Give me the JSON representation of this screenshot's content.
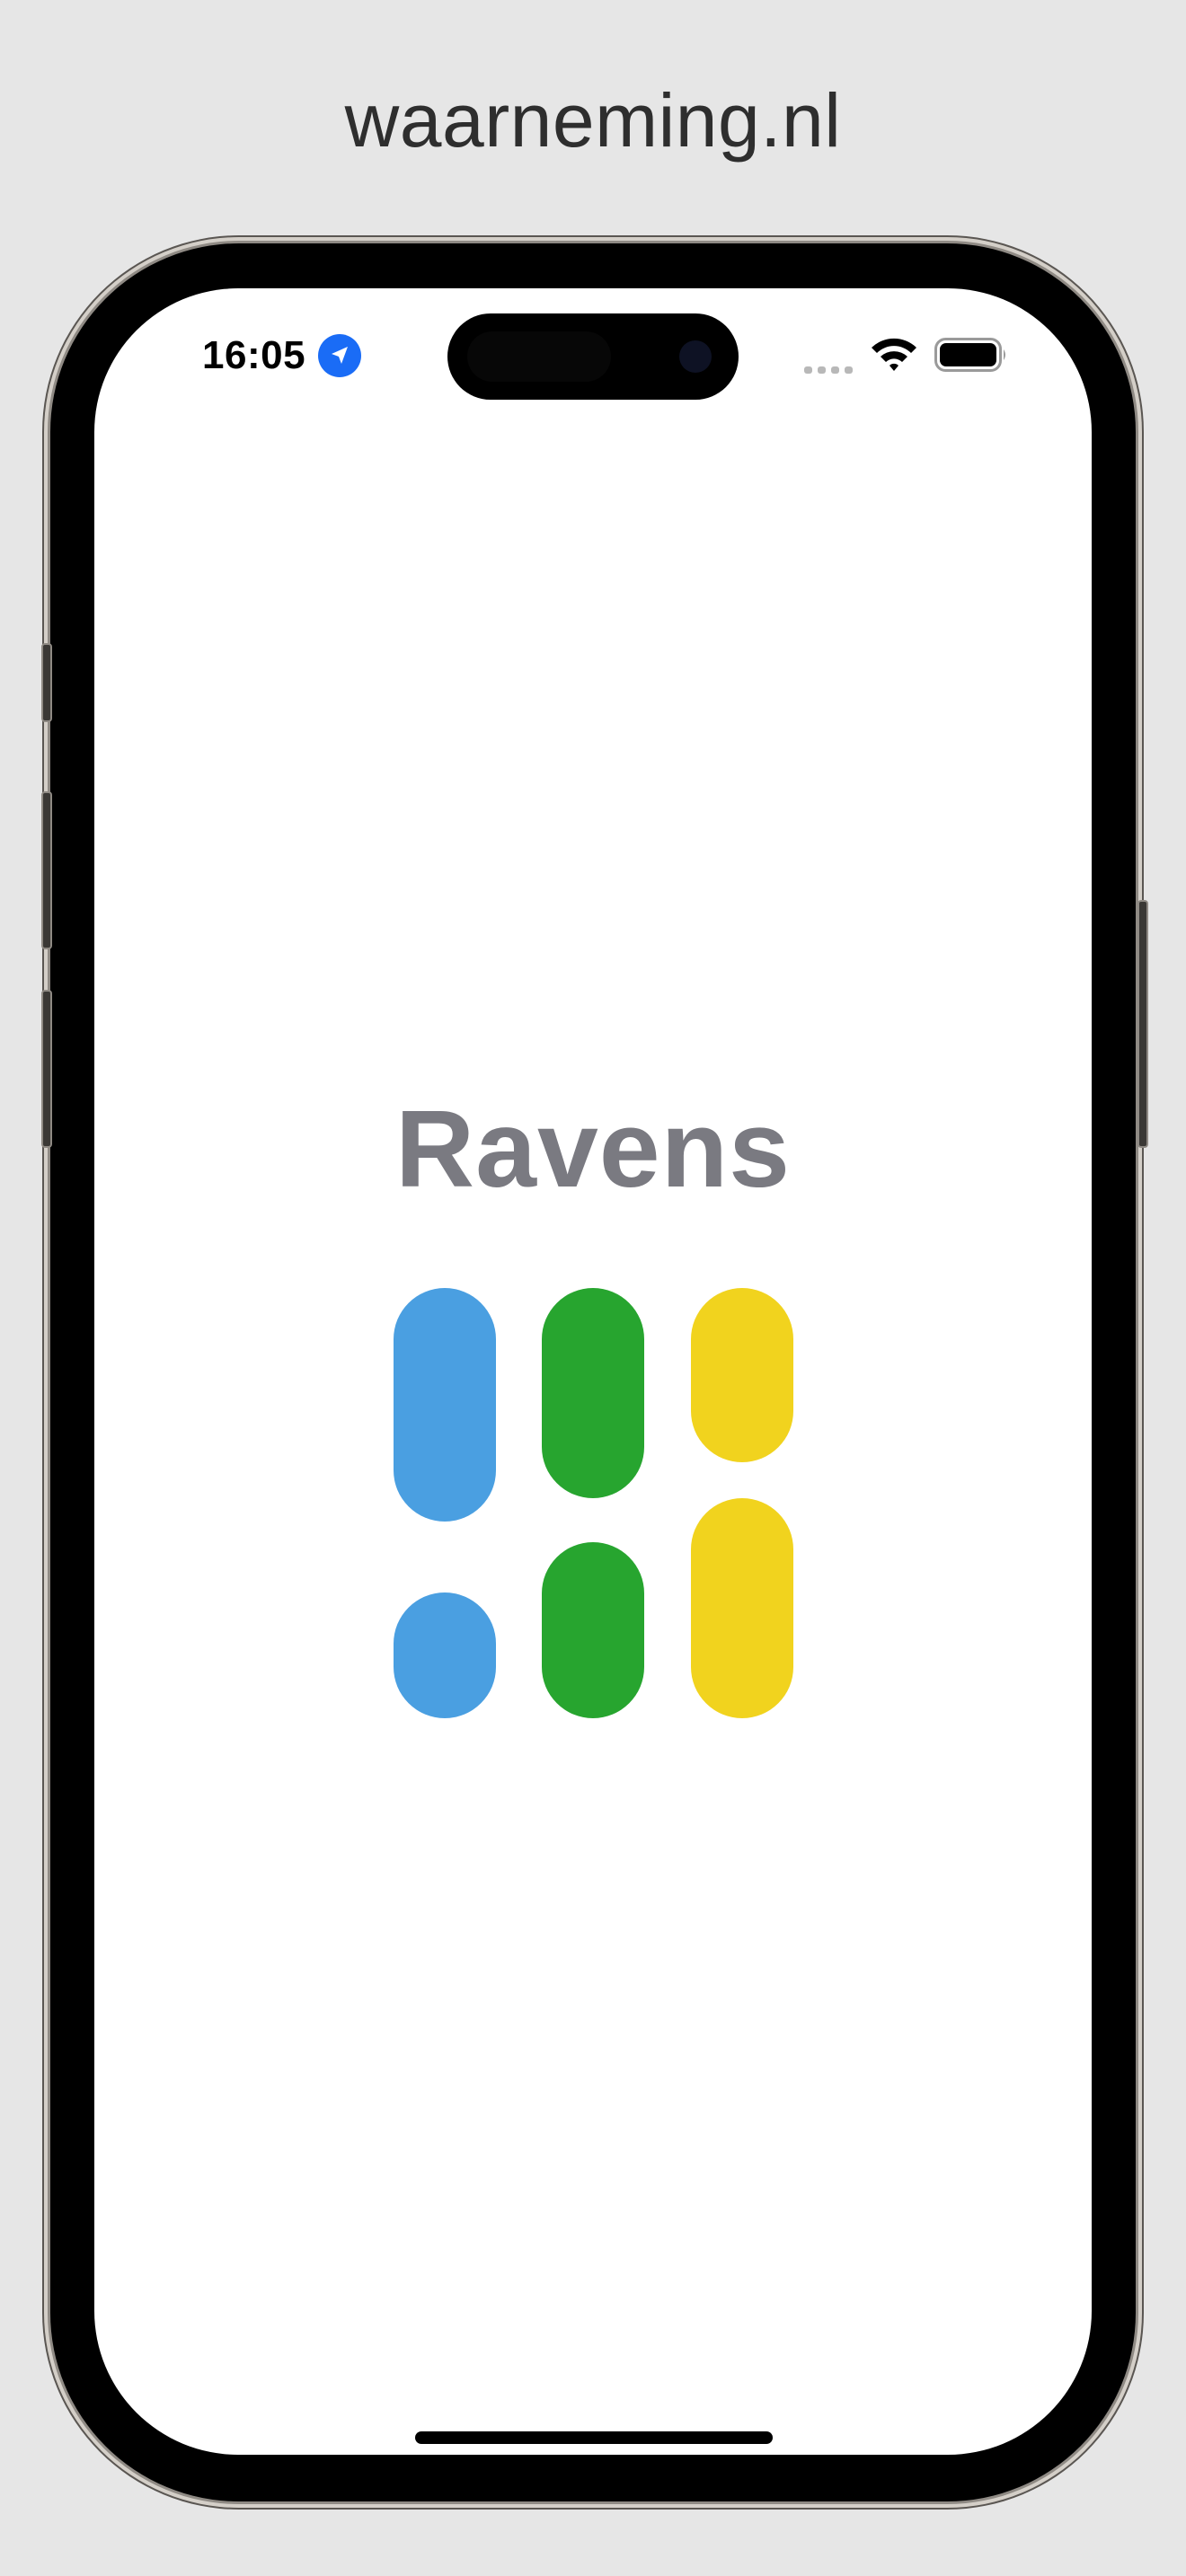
{
  "page": {
    "caption": "waarneming.nl",
    "background": "#e6e6e6"
  },
  "status_bar": {
    "time": "16:05",
    "location_icon": "location-arrow-icon",
    "signal_icon": "cellular-signal-icon",
    "wifi_icon": "wifi-icon",
    "battery_icon": "battery-icon",
    "accent": "#1a6cf6"
  },
  "app": {
    "title": "Ravens",
    "title_color": "#7a7a81",
    "logo": {
      "icon": "ravens-logo-icon",
      "colors": {
        "blue": "#4a9fe1",
        "green": "#27a52f",
        "yellow": "#f1d31e"
      }
    }
  }
}
